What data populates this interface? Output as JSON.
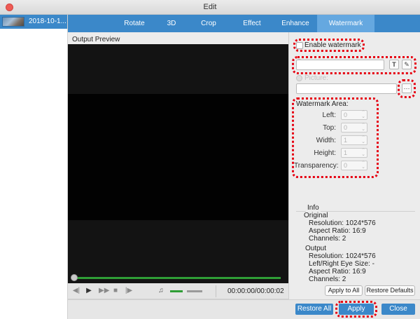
{
  "window": {
    "title": "Edit"
  },
  "sidebar": {
    "items": [
      {
        "label": "2018-10-1..."
      }
    ]
  },
  "tabs": [
    {
      "label": "Rotate"
    },
    {
      "label": "3D"
    },
    {
      "label": "Crop"
    },
    {
      "label": "Effect"
    },
    {
      "label": "Enhance"
    },
    {
      "label": "Watermark",
      "active": true
    }
  ],
  "preview": {
    "title": "Output Preview",
    "timecode": "00:00:00/00:00:02",
    "playback_progress": 0.0,
    "volume_level": 0.45
  },
  "watermark": {
    "enable_label": "Enable watermark",
    "enabled": false,
    "text_value": "",
    "text_icon": "T",
    "font_icon": "font-settings-icon",
    "picture_label": "Picture:",
    "picture_path": "",
    "browse_label": "···",
    "area_title": "Watermark Area:",
    "fields": [
      {
        "label": "Left:",
        "value": "0"
      },
      {
        "label": "Top:",
        "value": "0"
      },
      {
        "label": "Width:",
        "value": "1"
      },
      {
        "label": "Height:",
        "value": "1"
      },
      {
        "label": "Transparency:",
        "value": "0"
      }
    ]
  },
  "info": {
    "title": "Info",
    "original": {
      "heading": "Original",
      "resolution": "Resolution: 1024*576",
      "aspect": "Aspect Ratio: 16:9",
      "channels": "Channels: 2"
    },
    "output": {
      "heading": "Output",
      "resolution": "Resolution: 1024*576",
      "eye_size": "Left/Right Eye Size: -",
      "aspect": "Aspect Ratio: 16:9",
      "channels": "Channels: 2"
    }
  },
  "buttons": {
    "apply_to_all": "Apply to All",
    "restore_defaults": "Restore Defaults",
    "restore_all": "Restore All",
    "apply": "Apply",
    "close": "Close"
  },
  "colors": {
    "accent": "#3b88c9",
    "tab_active": "#65a8e0",
    "highlight": "#e60012",
    "progress": "#2f9e36"
  }
}
